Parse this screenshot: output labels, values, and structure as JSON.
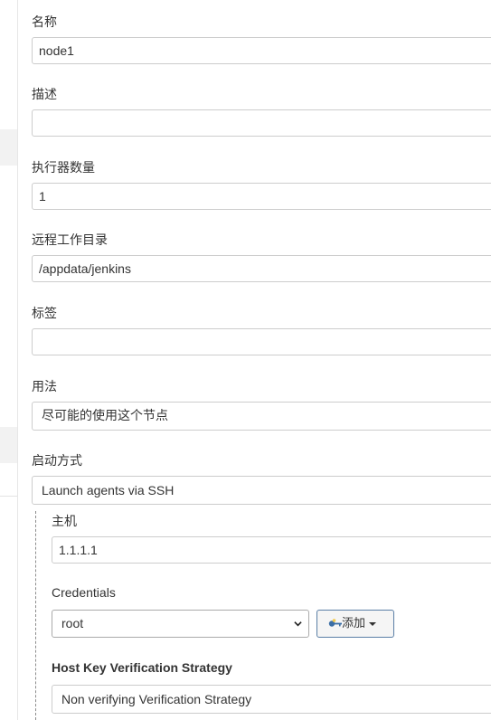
{
  "form": {
    "name": {
      "label": "名称",
      "value": "node1"
    },
    "description": {
      "label": "描述",
      "value": ""
    },
    "executors": {
      "label": "执行器数量",
      "value": "1"
    },
    "remote_root": {
      "label": "远程工作目录",
      "value": "/appdata/jenkins"
    },
    "labels": {
      "label": "标签",
      "value": ""
    },
    "usage": {
      "label": "用法",
      "selected": "尽可能的使用这个节点"
    },
    "launch_method": {
      "label": "启动方式",
      "selected": "Launch agents via SSH"
    },
    "ssh": {
      "host": {
        "label": "主机",
        "value": "1.1.1.1"
      },
      "credentials": {
        "label": "Credentials",
        "selected": "root",
        "add_label": "添加"
      },
      "host_key_strategy": {
        "label": "Host Key Verification Strategy",
        "selected": "Non verifying Verification Strategy"
      }
    }
  },
  "icons": {
    "select_arrow": "chevron-down-icon",
    "add_icon": "key-icon",
    "add_caret": "caret-down-icon"
  },
  "colors": {
    "border": "#cccccc",
    "button_border": "#5b7fa6",
    "sidebar_highlight": "#f2f2f2"
  }
}
